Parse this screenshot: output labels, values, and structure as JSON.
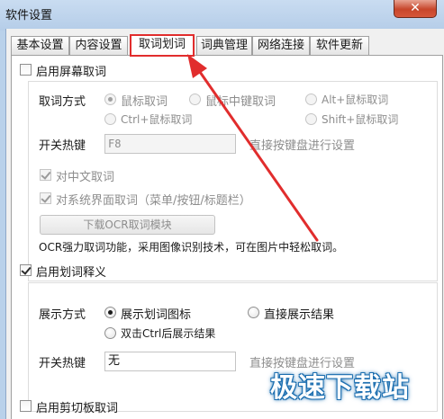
{
  "window": {
    "title": "软件设置",
    "close_label": "✕"
  },
  "tabs": [
    {
      "label": "基本设置",
      "active": false
    },
    {
      "label": "内容设置",
      "active": false
    },
    {
      "label": "取词划词",
      "active": true
    },
    {
      "label": "词典管理",
      "active": false
    },
    {
      "label": "网络连接",
      "active": false
    },
    {
      "label": "软件更新",
      "active": false
    }
  ],
  "screen_capture": {
    "enable_label": "启用屏幕取词",
    "enabled": false,
    "method_label": "取词方式",
    "methods": [
      {
        "label": "鼠标取词",
        "checked": true
      },
      {
        "label": "鼠标中键取词",
        "checked": false
      },
      {
        "label": "Alt+鼠标取词",
        "checked": false
      },
      {
        "label": "Ctrl+鼠标取词",
        "checked": false
      },
      {
        "label": "Shift+鼠标取词",
        "checked": false
      }
    ],
    "hotkey_label": "开关热键",
    "hotkey_value": "F8",
    "hotkey_hint": "直接按键盘进行设置",
    "chinese_label": "对中文取词",
    "chinese_checked": true,
    "ui_label": "对系统界面取词（菜单/按钮/标题栏）",
    "ui_checked": true,
    "ocr_button": "下载OCR取词模块",
    "ocr_desc": "OCR强力取词功能，采用图像识别技术，可在图片中轻松取词。"
  },
  "selection": {
    "enable_label": "启用划词释义",
    "enabled": true,
    "display_label": "展示方式",
    "displays": [
      {
        "label": "展示划词图标",
        "checked": true
      },
      {
        "label": "直接展示结果",
        "checked": false
      },
      {
        "label": "双击Ctrl后展示结果",
        "checked": false
      }
    ],
    "hotkey_label": "开关热键",
    "hotkey_value": "无",
    "hotkey_hint": "直接按键盘进行设置"
  },
  "clipboard": {
    "enable_label": "启用剪切板取词",
    "enabled": false
  },
  "watermark": {
    "text": "极速下载站"
  },
  "colors": {
    "highlight": "#e12d2d",
    "arrow": "#e12d2d",
    "title_bg": "#c9dcf1",
    "watermark_blue": "#1d6fb0"
  }
}
